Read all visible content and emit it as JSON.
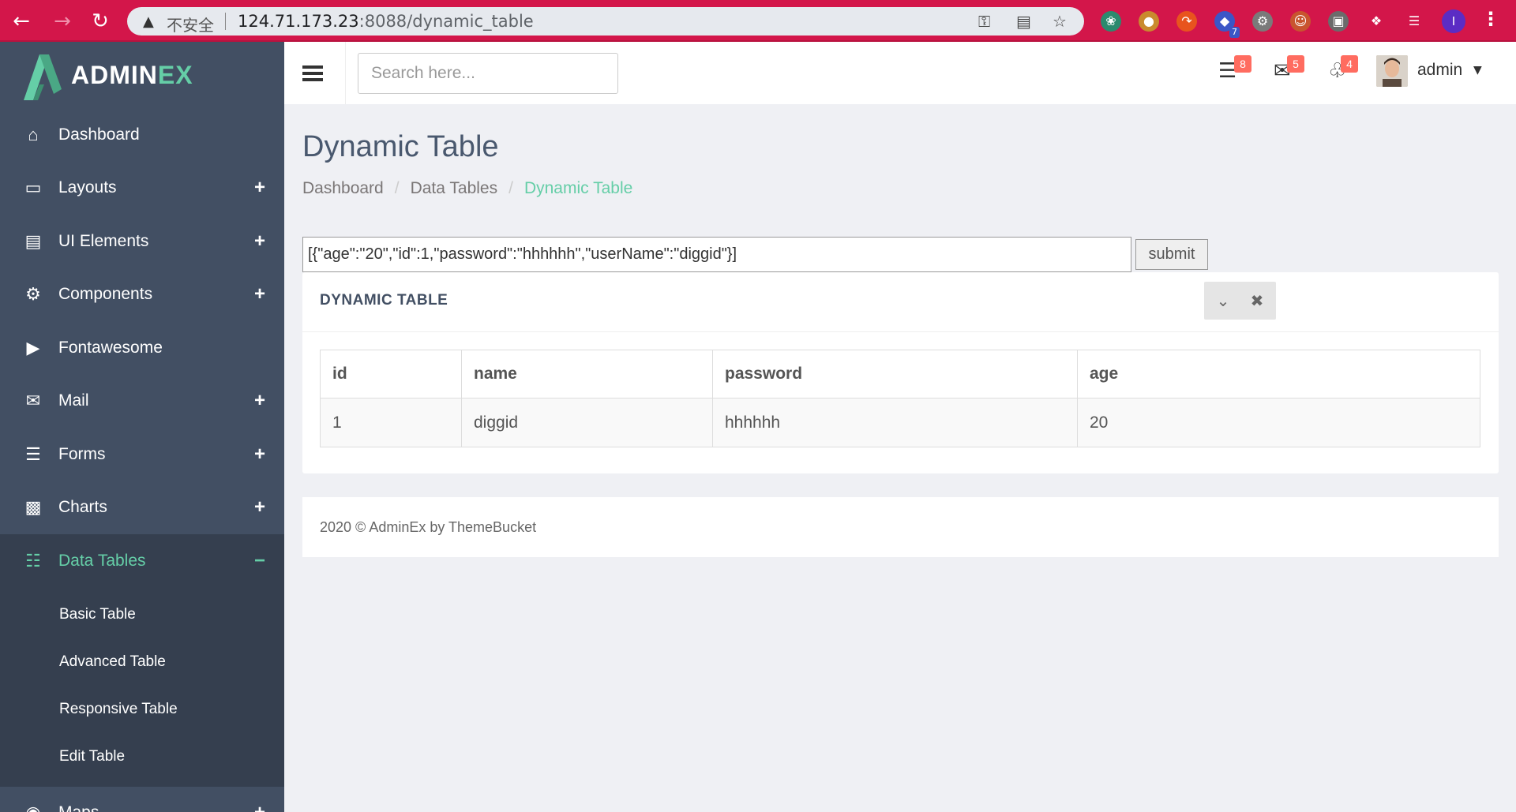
{
  "browser": {
    "back_icon": "arrow-left-icon",
    "forward_icon": "arrow-right-icon",
    "reload_icon": "reload-icon",
    "insecure_label": "不安全",
    "url_host": "124.71.173.23",
    "url_rest": ":8088/dynamic_table",
    "extension_badge": "7",
    "profile_initial": "I"
  },
  "sidebar": {
    "logo_text_main": "ADMIN",
    "logo_text_accent": "EX",
    "items": [
      {
        "label": "Dashboard",
        "icon": "home-icon",
        "expand": ""
      },
      {
        "label": "Layouts",
        "icon": "laptop-icon",
        "expand": "+"
      },
      {
        "label": "UI Elements",
        "icon": "book-icon",
        "expand": "+"
      },
      {
        "label": "Components",
        "icon": "cogs-icon",
        "expand": "+"
      },
      {
        "label": "Fontawesome",
        "icon": "bullhorn-icon",
        "expand": ""
      },
      {
        "label": "Mail",
        "icon": "envelope-icon",
        "expand": "+"
      },
      {
        "label": "Forms",
        "icon": "tasks-icon",
        "expand": "+"
      },
      {
        "label": "Charts",
        "icon": "bar-chart-icon",
        "expand": "+"
      },
      {
        "label": "Data Tables",
        "icon": "table-icon",
        "expand": "−"
      },
      {
        "label": "Maps",
        "icon": "map-marker-icon",
        "expand": "+"
      }
    ],
    "submenu": [
      "Basic Table",
      "Advanced Table",
      "Responsive Table",
      "Edit Table"
    ]
  },
  "header": {
    "search_placeholder": "Search here...",
    "tasks_count": "8",
    "mail_count": "5",
    "notifications_count": "4",
    "user_name": "admin"
  },
  "page": {
    "title": "Dynamic Table",
    "breadcrumb": [
      "Dashboard",
      "Data Tables",
      "Dynamic Table"
    ],
    "json_value": "[{\"age\":\"20\",\"id\":1,\"password\":\"hhhhhh\",\"userName\":\"diggid\"}]",
    "submit_label": "submit"
  },
  "panel": {
    "title": "DYNAMIC TABLE",
    "columns": [
      "id",
      "name",
      "password",
      "age"
    ],
    "rows": [
      [
        "1",
        "diggid",
        "hhhhhh",
        "20"
      ]
    ]
  },
  "footer": {
    "text": "2020 © AdminEx by ThemeBucket"
  },
  "colors": {
    "browser_bar": "#d3164a",
    "sidebar_bg": "#424f63",
    "sidebar_active_bg": "#353f4f",
    "accent": "#65cea7",
    "badge": "#ff6c60"
  }
}
